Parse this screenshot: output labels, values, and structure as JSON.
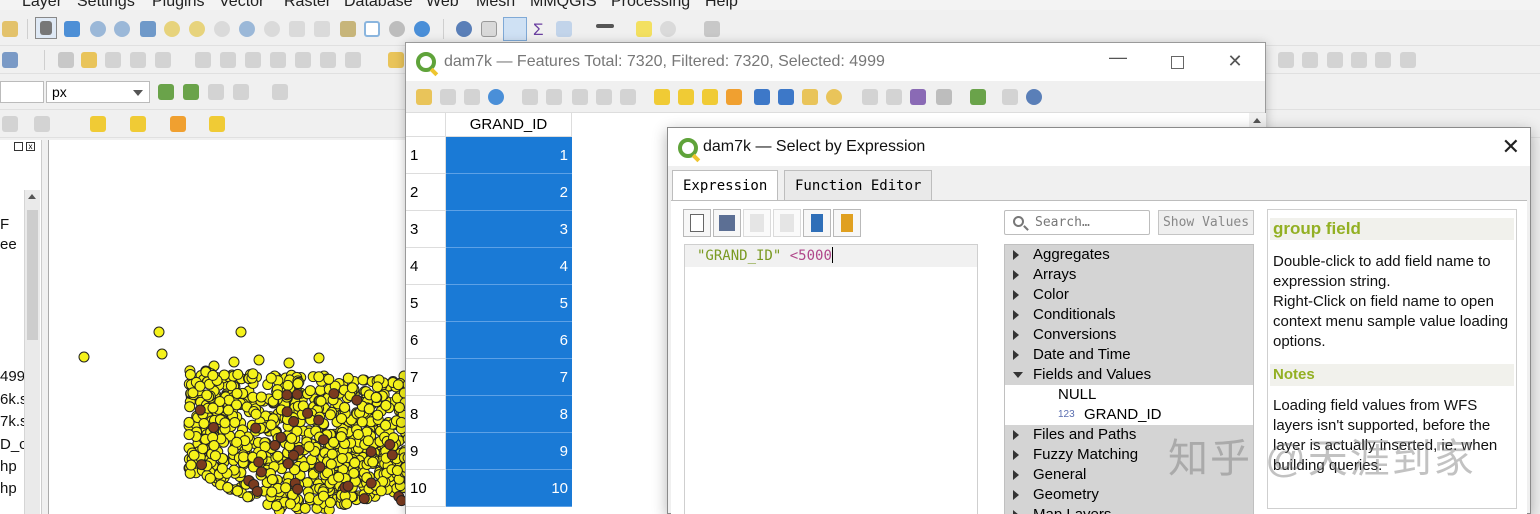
{
  "menubar": {
    "items": [
      "Layer",
      "Settings",
      "Plugins",
      "Vector",
      "Raster",
      "Database",
      "Web",
      "Mesh",
      "MMQGIS",
      "Processing",
      "Help"
    ]
  },
  "toolbar": {
    "unit_value": "px"
  },
  "layers_panel": {
    "partial_labels": [
      "F",
      "ee",
      "499",
      "6k.s",
      "7k.s",
      "D_c",
      "hp",
      "hp"
    ]
  },
  "attribute_table": {
    "title": "dam7k — Features Total: 7320, Filtered: 7320, Selected: 4999",
    "column_header": "GRAND_ID",
    "rows": [
      {
        "num": "1",
        "value": "1"
      },
      {
        "num": "2",
        "value": "2"
      },
      {
        "num": "3",
        "value": "3"
      },
      {
        "num": "4",
        "value": "4"
      },
      {
        "num": "5",
        "value": "5"
      },
      {
        "num": "6",
        "value": "6"
      },
      {
        "num": "7",
        "value": "7"
      },
      {
        "num": "8",
        "value": "8"
      },
      {
        "num": "9",
        "value": "9"
      },
      {
        "num": "10",
        "value": "10"
      }
    ],
    "selection_color": "#1a7ad6"
  },
  "select_dialog": {
    "title": "dam7k — Select by Expression",
    "tabs": [
      "Expression",
      "Function Editor"
    ],
    "expression": {
      "field": "\"GRAND_ID\"",
      "operator": " <5000"
    },
    "search_placeholder": "Search…",
    "show_values_label": "Show Values",
    "tree": [
      {
        "label": "Aggregates",
        "expanded": false
      },
      {
        "label": "Arrays",
        "expanded": false
      },
      {
        "label": "Color",
        "expanded": false
      },
      {
        "label": "Conditionals",
        "expanded": false
      },
      {
        "label": "Conversions",
        "expanded": false
      },
      {
        "label": "Date and Time",
        "expanded": false
      },
      {
        "label": "Fields and Values",
        "expanded": true
      },
      {
        "label": "NULL",
        "child": true
      },
      {
        "label": "GRAND_ID",
        "child": true,
        "badge": "123"
      },
      {
        "label": "Files and Paths",
        "expanded": false
      },
      {
        "label": "Fuzzy Matching",
        "expanded": false
      },
      {
        "label": "General",
        "expanded": false
      },
      {
        "label": "Geometry",
        "expanded": false
      },
      {
        "label": "Map Layers",
        "expanded": false
      }
    ],
    "help": {
      "heading": "group field",
      "p1": "Double-click to add field name to expression string.",
      "p2": "Right-Click on field name to open context menu sample value loading options.",
      "notes_heading": "Notes",
      "notes": "Loading field values from WFS layers isn't supported, before the layer is actually inserted, ie. when building queries."
    }
  },
  "watermark": "知乎 @天涯到家",
  "colors": {
    "qgis_green": "#5fa33a",
    "point_yellow": "#f5f21a",
    "point_brown": "#7a3b1f",
    "help_heading": "#93b023"
  }
}
